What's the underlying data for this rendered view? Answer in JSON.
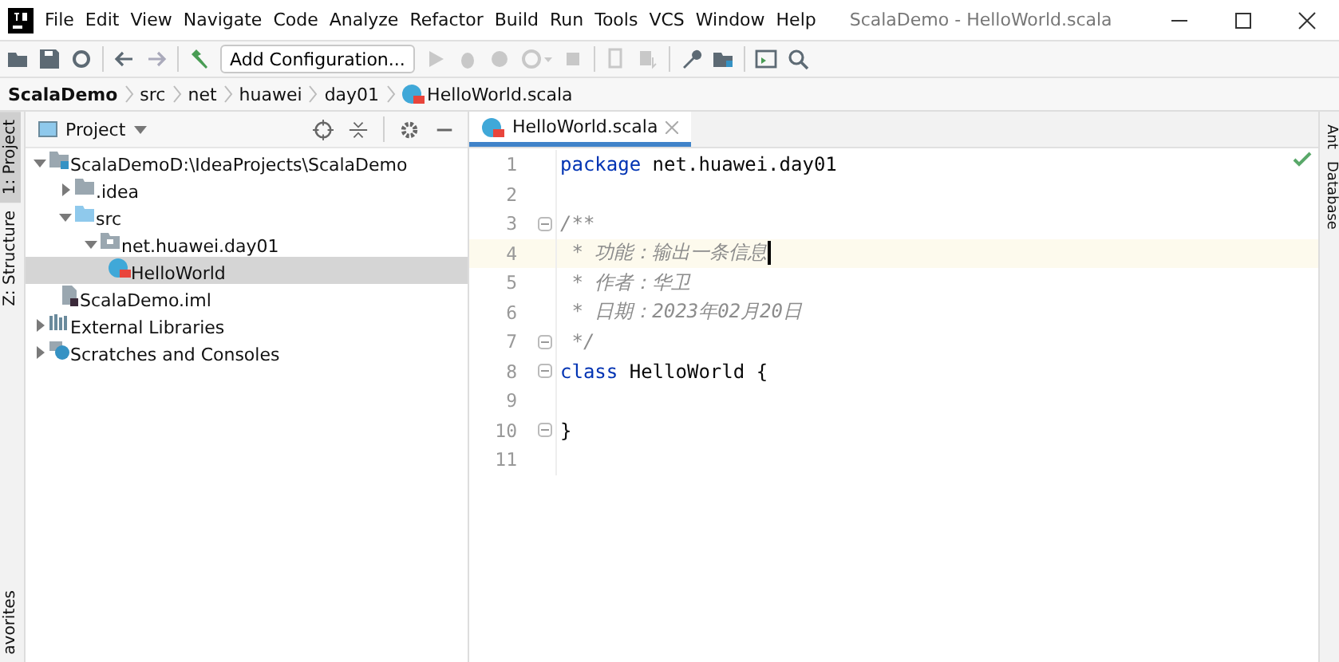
{
  "window": {
    "title": "ScalaDemo - HelloWorld.scala"
  },
  "menu": [
    "File",
    "Edit",
    "View",
    "Navigate",
    "Code",
    "Analyze",
    "Refactor",
    "Build",
    "Run",
    "Tools",
    "VCS",
    "Window",
    "Help"
  ],
  "toolbar": {
    "run_config": "Add Configuration..."
  },
  "breadcrumbs": [
    {
      "label": "ScalaDemo",
      "kind": "module"
    },
    {
      "label": "src",
      "kind": "dir"
    },
    {
      "label": "net",
      "kind": "dir"
    },
    {
      "label": "huawei",
      "kind": "dir"
    },
    {
      "label": "day01",
      "kind": "dir"
    },
    {
      "label": "HelloWorld.scala",
      "kind": "scala"
    }
  ],
  "left_stripe": [
    {
      "label": "1: Project",
      "selected": true
    },
    {
      "label": "Z: Structure",
      "selected": false
    }
  ],
  "left_stripe_bottom": "avorites",
  "project_panel": {
    "title": "Project",
    "tree": [
      {
        "label": "ScalaDemo",
        "path": "D:\\IdeaProjects\\ScalaDemo",
        "kind": "module",
        "expanded": true,
        "selected": false,
        "children": [
          {
            "label": ".idea",
            "kind": "folder",
            "expanded": false,
            "selected": false
          },
          {
            "label": "src",
            "kind": "source",
            "expanded": true,
            "selected": false,
            "children": [
              {
                "label": "net.huawei.day01",
                "kind": "package",
                "expanded": true,
                "selected": false,
                "children": [
                  {
                    "label": "HelloWorld",
                    "kind": "scala",
                    "selected": true
                  }
                ]
              }
            ]
          },
          {
            "label": "ScalaDemo.iml",
            "kind": "iml",
            "selected": false
          }
        ]
      },
      {
        "label": "External Libraries",
        "kind": "libraries",
        "expanded": false,
        "selected": false
      },
      {
        "label": "Scratches and Consoles",
        "kind": "scratches",
        "expanded": false,
        "selected": false
      }
    ]
  },
  "editor_tabs": [
    {
      "label": "HelloWorld.scala",
      "selected": true
    }
  ],
  "code": [
    {
      "number": "1",
      "tokens": [
        {
          "kind": "keyword",
          "text": "package"
        },
        {
          "kind": "plain",
          "text": " net.huawei.day01"
        }
      ]
    },
    {
      "number": "2"
    },
    {
      "number": "3",
      "fold": true,
      "tokens": [
        {
          "kind": "comment",
          "text": "/**"
        }
      ]
    },
    {
      "number": "4",
      "current": true,
      "tokens": [
        {
          "kind": "comment",
          "text": " * 功能：输出一条信息"
        }
      ]
    },
    {
      "number": "5",
      "tokens": [
        {
          "kind": "comment",
          "text": " * 作者：华卫"
        }
      ]
    },
    {
      "number": "6",
      "tokens": [
        {
          "kind": "comment",
          "text": " * 日期：2023年02月20日"
        }
      ]
    },
    {
      "number": "7",
      "fold": true,
      "tokens": [
        {
          "kind": "comment",
          "text": " */"
        }
      ]
    },
    {
      "number": "8",
      "fold": true,
      "tokens": [
        {
          "kind": "keyword",
          "text": "class"
        },
        {
          "kind": "plain",
          "text": " HelloWorld {"
        }
      ]
    },
    {
      "number": "9"
    },
    {
      "number": "10",
      "fold": true,
      "tokens": [
        {
          "kind": "plain",
          "text": "}"
        }
      ]
    },
    {
      "number": "11"
    }
  ],
  "right_stripe": [
    "Ant",
    "Database"
  ]
}
